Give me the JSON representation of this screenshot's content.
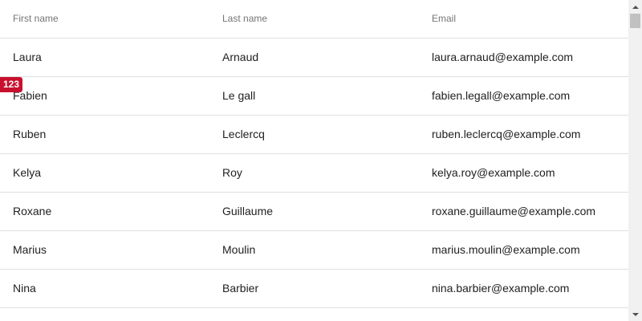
{
  "table": {
    "headers": {
      "first_name": "First name",
      "last_name": "Last name",
      "email": "Email"
    },
    "rows": [
      {
        "first_name": "Laura",
        "last_name": "Arnaud",
        "email": "laura.arnaud@example.com"
      },
      {
        "first_name": "Fabien",
        "last_name": "Le gall",
        "email": "fabien.legall@example.com"
      },
      {
        "first_name": "Ruben",
        "last_name": "Leclercq",
        "email": "ruben.leclercq@example.com"
      },
      {
        "first_name": "Kelya",
        "last_name": "Roy",
        "email": "kelya.roy@example.com"
      },
      {
        "first_name": "Roxane",
        "last_name": "Guillaume",
        "email": "roxane.guillaume@example.com"
      },
      {
        "first_name": "Marius",
        "last_name": "Moulin",
        "email": "marius.moulin@example.com"
      },
      {
        "first_name": "Nina",
        "last_name": "Barbier",
        "email": "nina.barbier@example.com"
      }
    ]
  },
  "badge": {
    "count": "123",
    "color": "#c8102e"
  },
  "colors": {
    "header_text": "#757575",
    "cell_text": "#212121",
    "divider": "#e0e0e0"
  },
  "icons": {
    "scroll_up": "triangle-up-icon",
    "scroll_down": "triangle-down-icon"
  }
}
